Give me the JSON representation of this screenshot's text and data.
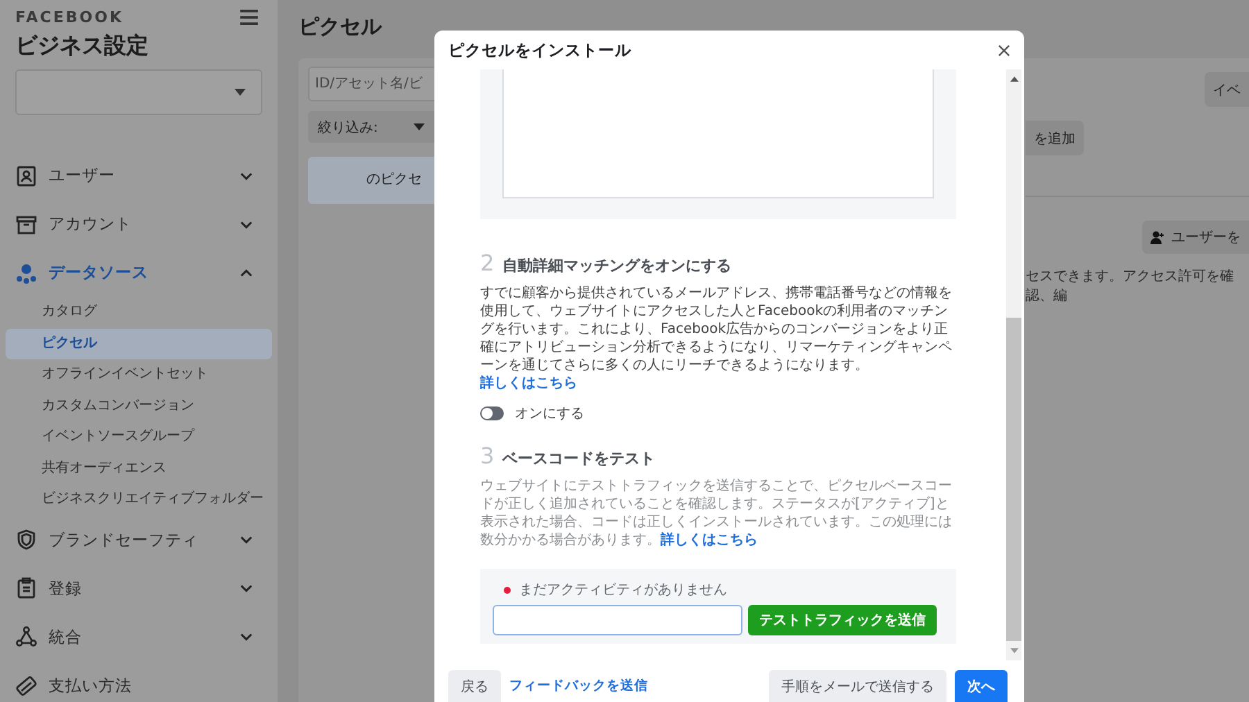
{
  "brand": "FACEBOOK",
  "sidebar": {
    "title": "ビジネス設定",
    "items": [
      {
        "label": "ユーザー",
        "kind": "group",
        "expanded": false,
        "active": false
      },
      {
        "label": "アカウント",
        "kind": "group",
        "expanded": false,
        "active": false
      },
      {
        "label": "データソース",
        "kind": "group",
        "expanded": true,
        "active": true,
        "children": [
          {
            "label": "カタログ",
            "selected": false
          },
          {
            "label": "ピクセル",
            "selected": true
          },
          {
            "label": "オフラインイベントセット",
            "selected": false
          },
          {
            "label": "カスタムコンバージョン",
            "selected": false
          },
          {
            "label": "イベントソースグループ",
            "selected": false
          },
          {
            "label": "共有オーディエンス",
            "selected": false
          },
          {
            "label": "ビジネスクリエイティブフォルダー",
            "selected": false
          }
        ]
      },
      {
        "label": "ブランドセーフティ",
        "kind": "group",
        "expanded": false,
        "active": false
      },
      {
        "label": "登録",
        "kind": "group",
        "expanded": false,
        "active": false
      },
      {
        "label": "統合",
        "kind": "group",
        "expanded": false,
        "active": false
      },
      {
        "label": "支払い方法",
        "kind": "link",
        "active": false
      }
    ]
  },
  "main": {
    "title": "ピクセル",
    "search": {
      "placeholder": "ID/アセット名/ビ"
    },
    "filter": {
      "label": "絞り込み:"
    },
    "pixel_list": [
      {
        "label": "のピクセ",
        "selected": true
      }
    ],
    "events_button": "イベ",
    "add_button": "を追加",
    "add_user_button": "ユーザーを",
    "access_note": "セスできます。アクセス許可を確認、編"
  },
  "modal": {
    "title": "ピクセルをインストール",
    "steps": [
      {
        "number": "2",
        "title": "自動詳細マッチングをオンにする",
        "body": "すでに顧客から提供されているメールアドレス、携帯電話番号などの情報を使用して、ウェブサイトにアクセスした人とFacebookの利用者のマッチングを行います。これにより、Facebook広告からのコンバージョンをより正確にアトリビューション分析できるようになり、リマーケティングキャンペーンを通じてさらに多くの人にリーチできるようになります。",
        "link": "詳しくはこちら",
        "toggle": {
          "label": "オンにする",
          "on": false
        }
      },
      {
        "number": "3",
        "title": "ベースコードをテスト",
        "body": "ウェブサイトにテストトラフィックを送信することで、ピクセルベースコードが正しく追加されていることを確認します。ステータスが[アクティブ]と表示された場合、コードは正しくインストールされています。この処理には数分かかる場合があります。",
        "link": "詳しくはこちら"
      }
    ],
    "test": {
      "status": "まだアクティビティがありません",
      "active": false,
      "button": "テストトラフィックを送信"
    },
    "footer": {
      "back": "戻る",
      "feedback_link": "フィードバックを送信",
      "email_button": "手順をメールで送信する",
      "next": "次へ"
    }
  }
}
